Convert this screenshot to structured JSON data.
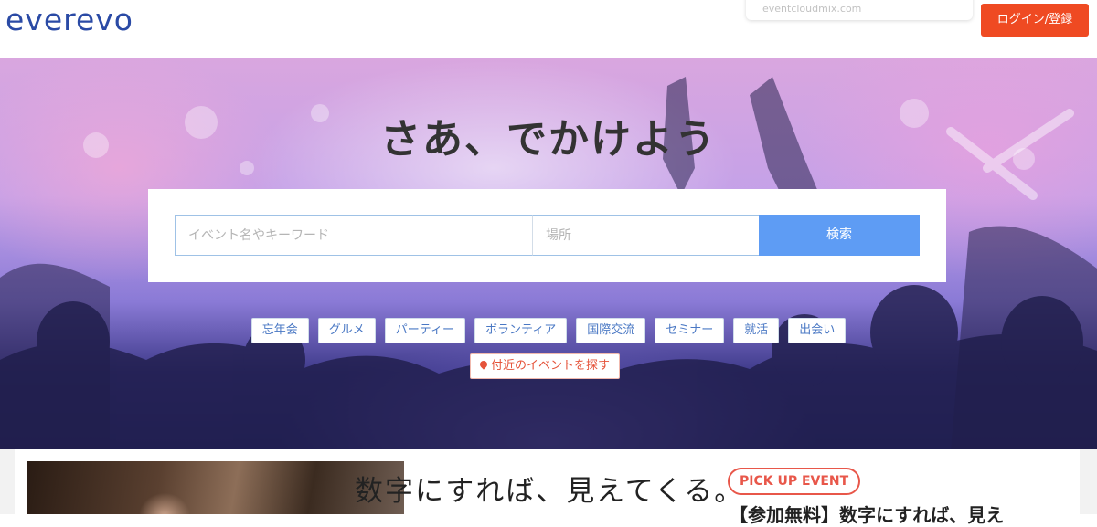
{
  "header": {
    "logo": "everevo",
    "search_hint": "eventcloudmix.com",
    "login_label": "ログイン/登録"
  },
  "hero": {
    "title": "さあ、でかけよう",
    "search": {
      "keyword_placeholder": "イベント名やキーワード",
      "place_placeholder": "場所",
      "button_label": "検索"
    },
    "tags": [
      "忘年会",
      "グルメ",
      "パーティー",
      "ボランティア",
      "国際交流",
      "セミナー",
      "就活",
      "出会い"
    ],
    "nearby_label": "付近のイベントを探す"
  },
  "pickup": {
    "photo_caption": "数字にすれば、見えてくる。",
    "badge": "PICK UP EVENT",
    "title": "【参加無料】数字にすれば、見え"
  },
  "colors": {
    "brand": "#2a4aa5",
    "login": "#ef4a22",
    "search_button": "#5e9cf4",
    "tag_text": "#4a78c4",
    "nearby": "#e5533a",
    "pickup_badge": "#e8574a"
  },
  "icons": {
    "nearby": "map-pin-icon"
  }
}
